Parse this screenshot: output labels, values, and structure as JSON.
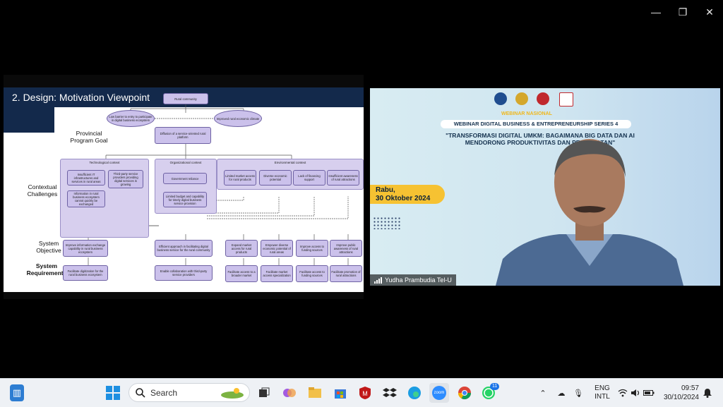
{
  "window_controls": {
    "minimize": "—",
    "restore": "❐",
    "close": "✕"
  },
  "slide": {
    "title": "2. Design: Motivation Viewpoint",
    "row_labels": {
      "goal": "Provincial\nProgram Goal",
      "challenges": "Contextual\nChallenges",
      "objective": "System\nObjective",
      "requirements": "System\nRequirements"
    },
    "top": {
      "rural_community": "Rural community",
      "low_barrier": "Low barrier to entry to participate in digital business ecosystem",
      "improved_climate": "Improved rural economic climate",
      "diffusion": "Diffusion of a service-oriented rural platform"
    },
    "contexts": {
      "tech": "Technological context",
      "org": "Organizational context",
      "env": "Environmental context"
    },
    "challenges": {
      "insufficient_it": "Insufficient IT infrastructures and services in rural areas",
      "third_party": "Third-party service providers providing digital services is growing",
      "info_rural": "Information in rural business ecosystem cannot quickly be exchanged",
      "gov_reliance": "Government reliance",
      "limited_budget": "Limited budget and capability for timely digital business service provision",
      "limited_market": "Limited market access for rural products",
      "diverse_potential": "Diverse economic potential",
      "lack_financing": "Lack of financing support",
      "insufficient_awareness": "Insufficient awareness of rural attractions"
    },
    "objectives": {
      "improve_info": "Improve information exchange capability in rural business ecosystem",
      "efficient": "Efficient approach in facilitating digital business service for the rural community",
      "expand_market": "Expand market access for rural products",
      "empower": "Empower diverse economic potential of rural areas",
      "improve_funding": "Improve access to funding sources",
      "improve_awareness": "Improve public awareness of rural attractions"
    },
    "requirements": {
      "facilitate_digitization": "Facilitate digitization for the rural business ecosystem",
      "enable_collab": "Enable collaboration with third-party service providers",
      "facilitate_market": "Facilitate access to a broader market",
      "facilitate_specialization": "Facilitate market access specialization",
      "facilitate_funding": "Facilitate access to funding sources",
      "facilitate_promotion": "Facilitate promotion of rural attractions"
    }
  },
  "video": {
    "subtitle": "WEBINAR NASIONAL",
    "series_title": "WEBINAR DIGITAL BUSINESS & ENTREPRENEURSHIP SERIES 4",
    "headline": "\"TRANSFORMASI DIGITAL UMKM: BAGAIMANA BIG DATA DAN AI MENDORONG PRODUKTIVITAS DAN PENDAPATAN\"",
    "date_line1": "Rabu,",
    "date_line2": "30 Oktober 2024",
    "participant_name": "Yudha Prambudia Tel-U",
    "colors": {
      "accent_yellow": "#f6c232",
      "navy": "#15324f"
    }
  },
  "taskbar": {
    "search_placeholder": "Search",
    "language_line1": "ENG",
    "language_line2": "INTL",
    "time": "09:57",
    "date": "30/10/2024",
    "whatsapp_badge": "11",
    "zoom_label": "zoom"
  }
}
